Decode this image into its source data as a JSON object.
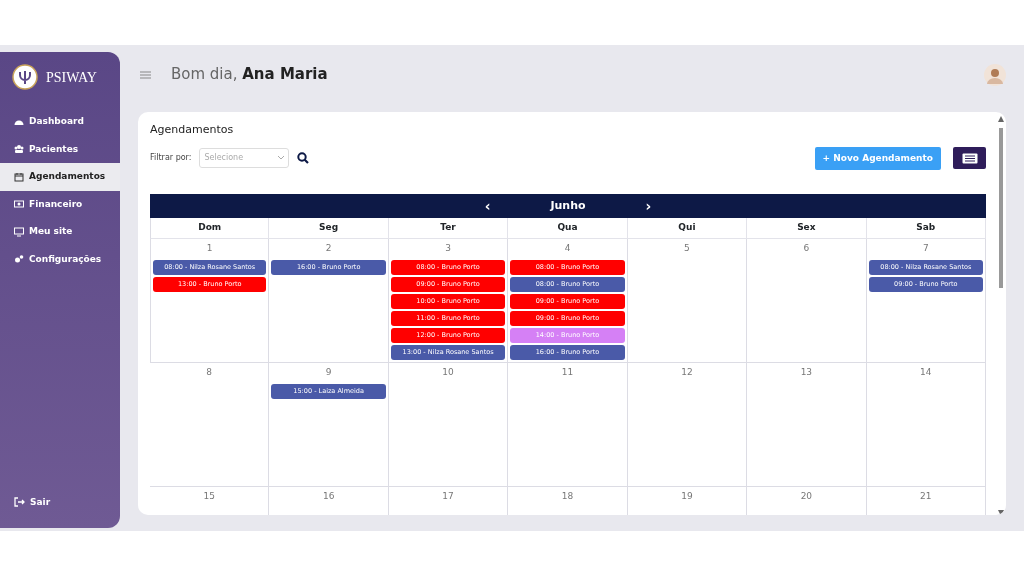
{
  "sidebar": {
    "brand": "PSIWAY",
    "items": [
      {
        "label": "Dashboard",
        "selected": false
      },
      {
        "label": "Pacientes",
        "selected": false
      },
      {
        "label": "Agendamentos",
        "selected": true
      },
      {
        "label": "Financeiro",
        "selected": false
      },
      {
        "label": "Meu site",
        "selected": false
      },
      {
        "label": "Configurações",
        "selected": false
      }
    ],
    "logout": "Sair"
  },
  "header": {
    "greeting": "Bom dia,",
    "user": "Ana Maria"
  },
  "card": {
    "title": "Agendamentos",
    "filter_label": "Filtrar por:",
    "filter_placeholder": "Selecione",
    "new_button": "+ Novo Agendamento"
  },
  "calendar": {
    "month": "Junho",
    "prev": "‹",
    "next": "›",
    "weekdays": [
      "Dom",
      "Seg",
      "Ter",
      "Qua",
      "Qui",
      "Sex",
      "Sab"
    ],
    "weeks": [
      {
        "days": [
          {
            "day": "1",
            "events": [
              {
                "text": "08:00 - Nilza Rosane Santos",
                "color": "#4a5aa8"
              },
              {
                "text": "13:00 - Bruno Porto",
                "color": "#ff0000"
              }
            ]
          },
          {
            "day": "2",
            "events": [
              {
                "text": "16:00 - Bruno Porto",
                "color": "#4a5aa8"
              }
            ]
          },
          {
            "day": "3",
            "events": [
              {
                "text": "08:00 - Bruno Porto",
                "color": "#ff0000"
              },
              {
                "text": "09:00 - Bruno Porto",
                "color": "#ff0000"
              },
              {
                "text": "10:00 - Bruno Porto",
                "color": "#ff0000"
              },
              {
                "text": "11:00 - Bruno Porto",
                "color": "#ff0000"
              },
              {
                "text": "12:00 - Bruno Porto",
                "color": "#ff0000"
              },
              {
                "text": "13:00 - Nilza Rosane Santos",
                "color": "#4a5aa8"
              }
            ]
          },
          {
            "day": "4",
            "events": [
              {
                "text": "08:00 - Bruno Porto",
                "color": "#ff0000"
              },
              {
                "text": "08:00 - Bruno Porto",
                "color": "#4a5aa8"
              },
              {
                "text": "09:00 - Bruno Porto",
                "color": "#ff0000"
              },
              {
                "text": "09:00 - Bruno Porto",
                "color": "#ff0000"
              },
              {
                "text": "14:00 - Bruno Porto",
                "color": "#d580f5"
              },
              {
                "text": "16:00 - Bruno Porto",
                "color": "#4a5aa8"
              }
            ]
          },
          {
            "day": "5"
          },
          {
            "day": "6"
          },
          {
            "day": "7",
            "events": [
              {
                "text": "08:00 - Nilza Rosane Santos",
                "color": "#4a5aa8"
              },
              {
                "text": "09:00 - Bruno Porto",
                "color": "#4a5aa8"
              }
            ]
          }
        ]
      },
      {
        "days": [
          {
            "day": "8"
          },
          {
            "day": "9",
            "events": [
              {
                "text": "15:00 - Laiza Almeida",
                "color": "#4a5aa8"
              }
            ]
          },
          {
            "day": "10"
          },
          {
            "day": "11"
          },
          {
            "day": "12"
          },
          {
            "day": "13"
          },
          {
            "day": "14"
          }
        ]
      },
      {
        "days": [
          {
            "day": "15"
          },
          {
            "day": "16"
          },
          {
            "day": "17"
          },
          {
            "day": "18"
          },
          {
            "day": "19"
          },
          {
            "day": "20"
          },
          {
            "day": "21"
          }
        ]
      }
    ]
  }
}
